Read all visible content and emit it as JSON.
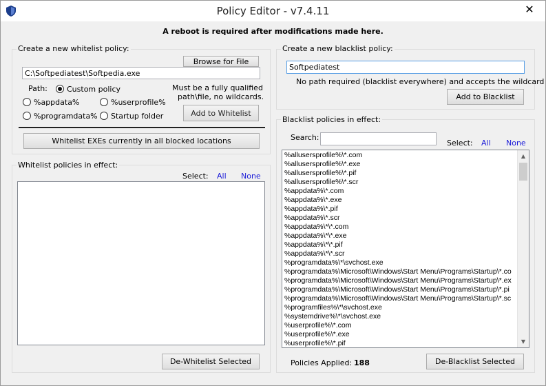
{
  "window": {
    "title": "Policy Editor - v7.4.11",
    "close_glyph": "✕"
  },
  "notice": "A reboot is required after modifications made here.",
  "whitelist_create": {
    "group_label": "Create a new whitelist policy:",
    "browse_label": "Browse for File",
    "path_value": "C:\\Softpediatest\\Softpedia.exe",
    "path_label": "Path:",
    "radio_custom": "Custom policy",
    "radio_appdata": "%appdata%",
    "radio_userprofile": "%userprofile%",
    "radio_programdata": "%programdata%",
    "radio_startup": "Startup folder",
    "hint_line1": "Must be a fully qualified",
    "hint_line2": "path\\file, no wildcards.",
    "add_label": "Add to Whitelist",
    "whitelist_all_label": "Whitelist EXEs currently in all blocked locations"
  },
  "whitelist_effect": {
    "group_label": "Whitelist policies in effect:",
    "select_label": "Select:",
    "all_label": "All",
    "none_label": "None",
    "items": [],
    "dewhitelist_label": "De-Whitelist Selected"
  },
  "blacklist_create": {
    "group_label": "Create a new blacklist policy:",
    "input_value": "Softpediatest",
    "hint": "No path required (blacklist everywhere) and accepts the wildcard *",
    "add_label": "Add to Blacklist"
  },
  "blacklist_effect": {
    "group_label": "Blacklist policies in effect:",
    "search_label": "Search:",
    "search_value": "",
    "select_label": "Select:",
    "all_label": "All",
    "none_label": "None",
    "items": [
      "%allusersprofile%\\*.com",
      "%allusersprofile%\\*.exe",
      "%allusersprofile%\\*.pif",
      "%allusersprofile%\\*.scr",
      "%appdata%\\*.com",
      "%appdata%\\*.exe",
      "%appdata%\\*.pif",
      "%appdata%\\*.scr",
      "%appdata%\\*\\*.com",
      "%appdata%\\*\\*.exe",
      "%appdata%\\*\\*.pif",
      "%appdata%\\*\\*.scr",
      "%programdata%\\*\\svchost.exe",
      "%programdata%\\Microsoft\\Windows\\Start Menu\\Programs\\Startup\\*.co",
      "%programdata%\\Microsoft\\Windows\\Start Menu\\Programs\\Startup\\*.ex",
      "%programdata%\\Microsoft\\Windows\\Start Menu\\Programs\\Startup\\*.pi",
      "%programdata%\\Microsoft\\Windows\\Start Menu\\Programs\\Startup\\*.sc",
      "%programfiles%\\*\\svchost.exe",
      "%systemdrive%\\*\\svchost.exe",
      "%userprofile%\\*.com",
      "%userprofile%\\*.exe",
      "%userprofile%\\*.pif"
    ],
    "policies_applied_label": "Policies Applied:",
    "policies_applied_count": "188",
    "deblacklist_label": "De-Blacklist Selected"
  }
}
